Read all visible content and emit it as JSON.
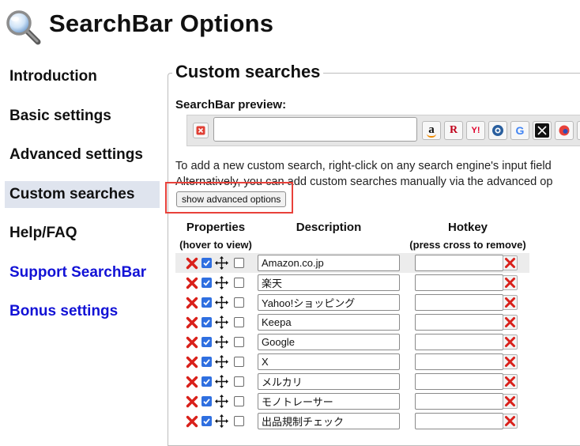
{
  "page_title": "SearchBar Options",
  "sidebar": {
    "items": [
      {
        "label": "Introduction"
      },
      {
        "label": "Basic settings"
      },
      {
        "label": "Advanced settings"
      },
      {
        "label": "Custom searches"
      },
      {
        "label": "Help/FAQ"
      },
      {
        "label": "Support SearchBar"
      },
      {
        "label": "Bonus settings"
      }
    ],
    "active_item": "Custom searches"
  },
  "section": {
    "title": "Custom searches",
    "preview_label": "SearchBar preview:",
    "preview_engines": [
      {
        "name": "Amazon",
        "icon": "amazon-icon",
        "glyph": "a"
      },
      {
        "name": "Rakuten",
        "icon": "rakuten-icon",
        "glyph": "R"
      },
      {
        "name": "Yahoo",
        "icon": "yahoo-icon",
        "glyph": "Y!"
      },
      {
        "name": "Keepa",
        "icon": "keepa-icon",
        "glyph": "●"
      },
      {
        "name": "Google",
        "icon": "google-icon",
        "glyph": "G"
      },
      {
        "name": "X",
        "icon": "x-icon",
        "glyph": "X"
      },
      {
        "name": "Mercari",
        "icon": "mercari-icon",
        "glyph": "●"
      }
    ],
    "help_line1": "To add a new custom search, right-click on any search engine's input field",
    "help_line2": "Alternatively, you can add custom searches manually via the advanced op",
    "advanced_button": "show advanced options"
  },
  "table": {
    "col_properties": "Properties",
    "col_properties_sub": "(hover to view)",
    "col_description": "Description",
    "col_hotkey": "Hotkey",
    "col_hotkey_sub": "(press cross to remove)",
    "rows": [
      {
        "description": "Amazon.co.jp",
        "enabled": true,
        "hotkey": ""
      },
      {
        "description": "楽天",
        "enabled": true,
        "hotkey": ""
      },
      {
        "description": "Yahoo!ショッピング",
        "enabled": true,
        "hotkey": ""
      },
      {
        "description": "Keepa",
        "enabled": true,
        "hotkey": ""
      },
      {
        "description": "Google",
        "enabled": true,
        "hotkey": ""
      },
      {
        "description": "X",
        "enabled": true,
        "hotkey": ""
      },
      {
        "description": "メルカリ",
        "enabled": true,
        "hotkey": ""
      },
      {
        "description": "モノトレーサー",
        "enabled": true,
        "hotkey": ""
      },
      {
        "description": "出品規制チェック",
        "enabled": true,
        "hotkey": ""
      }
    ]
  },
  "colors": {
    "link": "#1212d6",
    "active_bg": "#dfe4ee",
    "highlight": "#e8413a",
    "delete_red": "#d9201a",
    "checkbox": "#2f6fe0"
  }
}
